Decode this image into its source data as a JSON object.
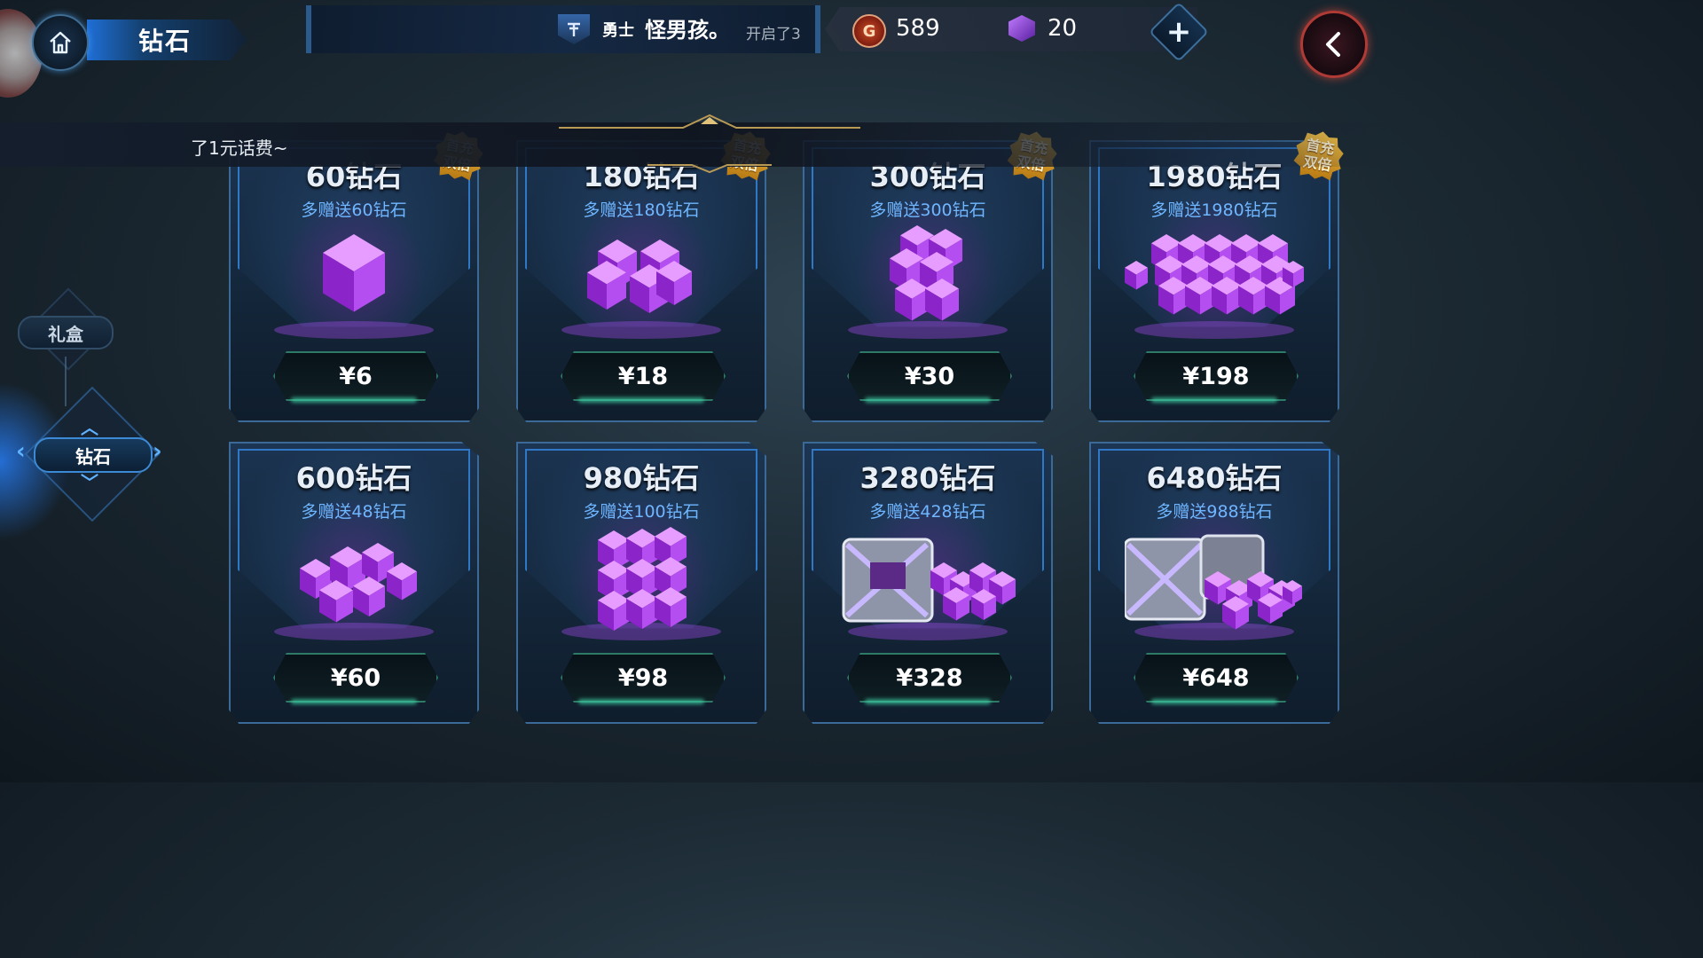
{
  "header": {
    "title": "钻石",
    "home_icon": "home-icon",
    "back_icon": "back-arrow-icon"
  },
  "broadcast_top": {
    "prefix": "勇士",
    "name": "怪男孩。",
    "suffix": "开启了3"
  },
  "currency": {
    "gold_symbol": "G",
    "gold": "589",
    "gems": "20",
    "add_icon": "plus-icon"
  },
  "notice": {
    "text": "了1元话费~"
  },
  "sidebar": {
    "items": [
      {
        "label": "礼盒"
      },
      {
        "label": "钻石"
      }
    ]
  },
  "badge_text": "首充双倍",
  "products": [
    {
      "name": "60钻石",
      "bonus": "多赠送60钻石",
      "price": "¥6",
      "badge": true
    },
    {
      "name": "180钻石",
      "bonus": "多赠送180钻石",
      "price": "¥18",
      "badge": true
    },
    {
      "name": "300钻石",
      "bonus": "多赠送300钻石",
      "price": "¥30",
      "badge": true
    },
    {
      "name": "1980钻石",
      "bonus": "多赠送1980钻石",
      "price": "¥198",
      "badge": true
    },
    {
      "name": "600钻石",
      "bonus": "多赠送48钻石",
      "price": "¥60",
      "badge": false
    },
    {
      "name": "980钻石",
      "bonus": "多赠送100钻石",
      "price": "¥98",
      "badge": false
    },
    {
      "name": "3280钻石",
      "bonus": "多赠送428钻石",
      "price": "¥328",
      "badge": false
    },
    {
      "name": "6480钻石",
      "bonus": "多赠送988钻石",
      "price": "¥648",
      "badge": false
    }
  ],
  "colors": {
    "accent_blue": "#3c8ad6",
    "gem_purple": "#b24cff",
    "price_border": "#2d7a66",
    "bonus_text": "#6fb6ff",
    "badge_gold": "#f5c54a"
  }
}
